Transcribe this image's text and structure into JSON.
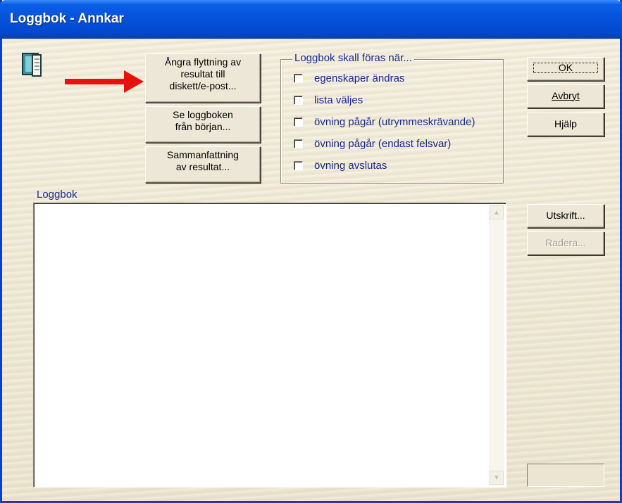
{
  "window": {
    "title": "Loggbok - Annkar"
  },
  "buttons": {
    "undo_line1": "Ångra flyttning av",
    "undo_line2": "resultat till",
    "undo_line3": "diskett/e-post...",
    "view_line1": "Se loggboken",
    "view_line2": "från början...",
    "summary_line1": "Sammanfattning",
    "summary_line2": "av resultat...",
    "ok": "OK",
    "cancel": "Avbryt",
    "help": "Hjälp",
    "print": "Utskrift...",
    "delete": "Radera..."
  },
  "group": {
    "title": "Loggbok skall föras när...",
    "options": [
      {
        "label": "egenskaper ändras",
        "checked": false
      },
      {
        "label": "lista väljes",
        "checked": false
      },
      {
        "label": "övning pågår (utrymmeskrävande)",
        "checked": false
      },
      {
        "label": "övning pågår (endast felsvar)",
        "checked": false
      },
      {
        "label": "övning avslutas",
        "checked": false
      }
    ]
  },
  "log": {
    "label": "Loggbok",
    "content": ""
  },
  "icons": {
    "app": "book-icon",
    "annotation": "red-arrow-icon"
  },
  "colors": {
    "title_bar": "#0452d9",
    "annotation_arrow": "#e8120c",
    "label_text": "#1a2a8c"
  }
}
